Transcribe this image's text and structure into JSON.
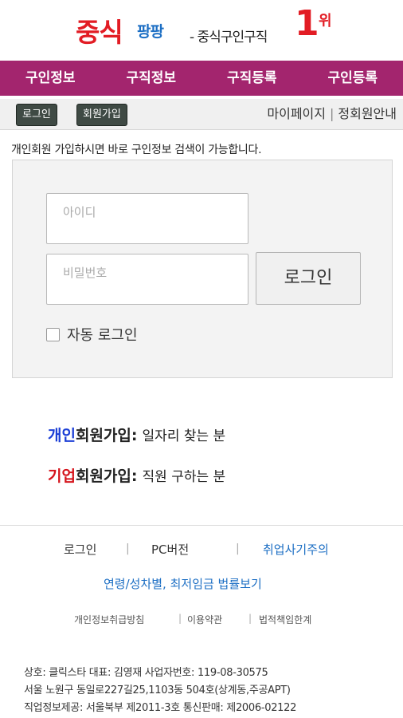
{
  "header": {
    "brand_main": "중식",
    "brand_sub": "팡팡",
    "tagline": "- 중식구인구직",
    "rank_num": "1",
    "rank_suffix": "위",
    "colors": {
      "red": "#e21c24",
      "blue": "#1d6fc4"
    }
  },
  "nav": {
    "bg_color": "#a3256e",
    "items": [
      {
        "label": "구인정보"
      },
      {
        "label": "구직정보"
      },
      {
        "label": "구직등록"
      },
      {
        "label": "구인등록"
      }
    ]
  },
  "subbar": {
    "login_label": "로그인",
    "join_label": "회원가입",
    "mypage_label": "마이페이지",
    "separator": "|",
    "member_info_label": "정회원안내"
  },
  "notice": "개인회원 가입하시면 바로 구인정보 검색이 가능합니다.",
  "login": {
    "id_placeholder": "아이디",
    "pw_placeholder": "비밀번호",
    "button_label": "로그인",
    "auto_login_label": "자동 로그인"
  },
  "join": {
    "personal": {
      "accent": "개인",
      "rest": "회원가입:",
      "desc": "일자리 찾는 분"
    },
    "company": {
      "accent": "기업",
      "rest": "회원가입:",
      "desc": "직원 구하는 분"
    }
  },
  "footer": {
    "links1": [
      "로그인",
      "PC버전",
      "취업사기주의"
    ],
    "sep": "|",
    "links2": "연령/성차별, 최저임금 법률보기",
    "links3": [
      "개인정보취급방침",
      "이용약관",
      "법적책임한계"
    ],
    "company_lines": [
      "상호: 클릭스타   대표: 김영재    사업자번호: 119-08-30575",
      "서울 노원구 동일로227길25,1103동 504호(상계동,주공APT)",
      "직업정보제공: 서울북부 제2011-3호  통신판매: 제2006-02122"
    ]
  }
}
